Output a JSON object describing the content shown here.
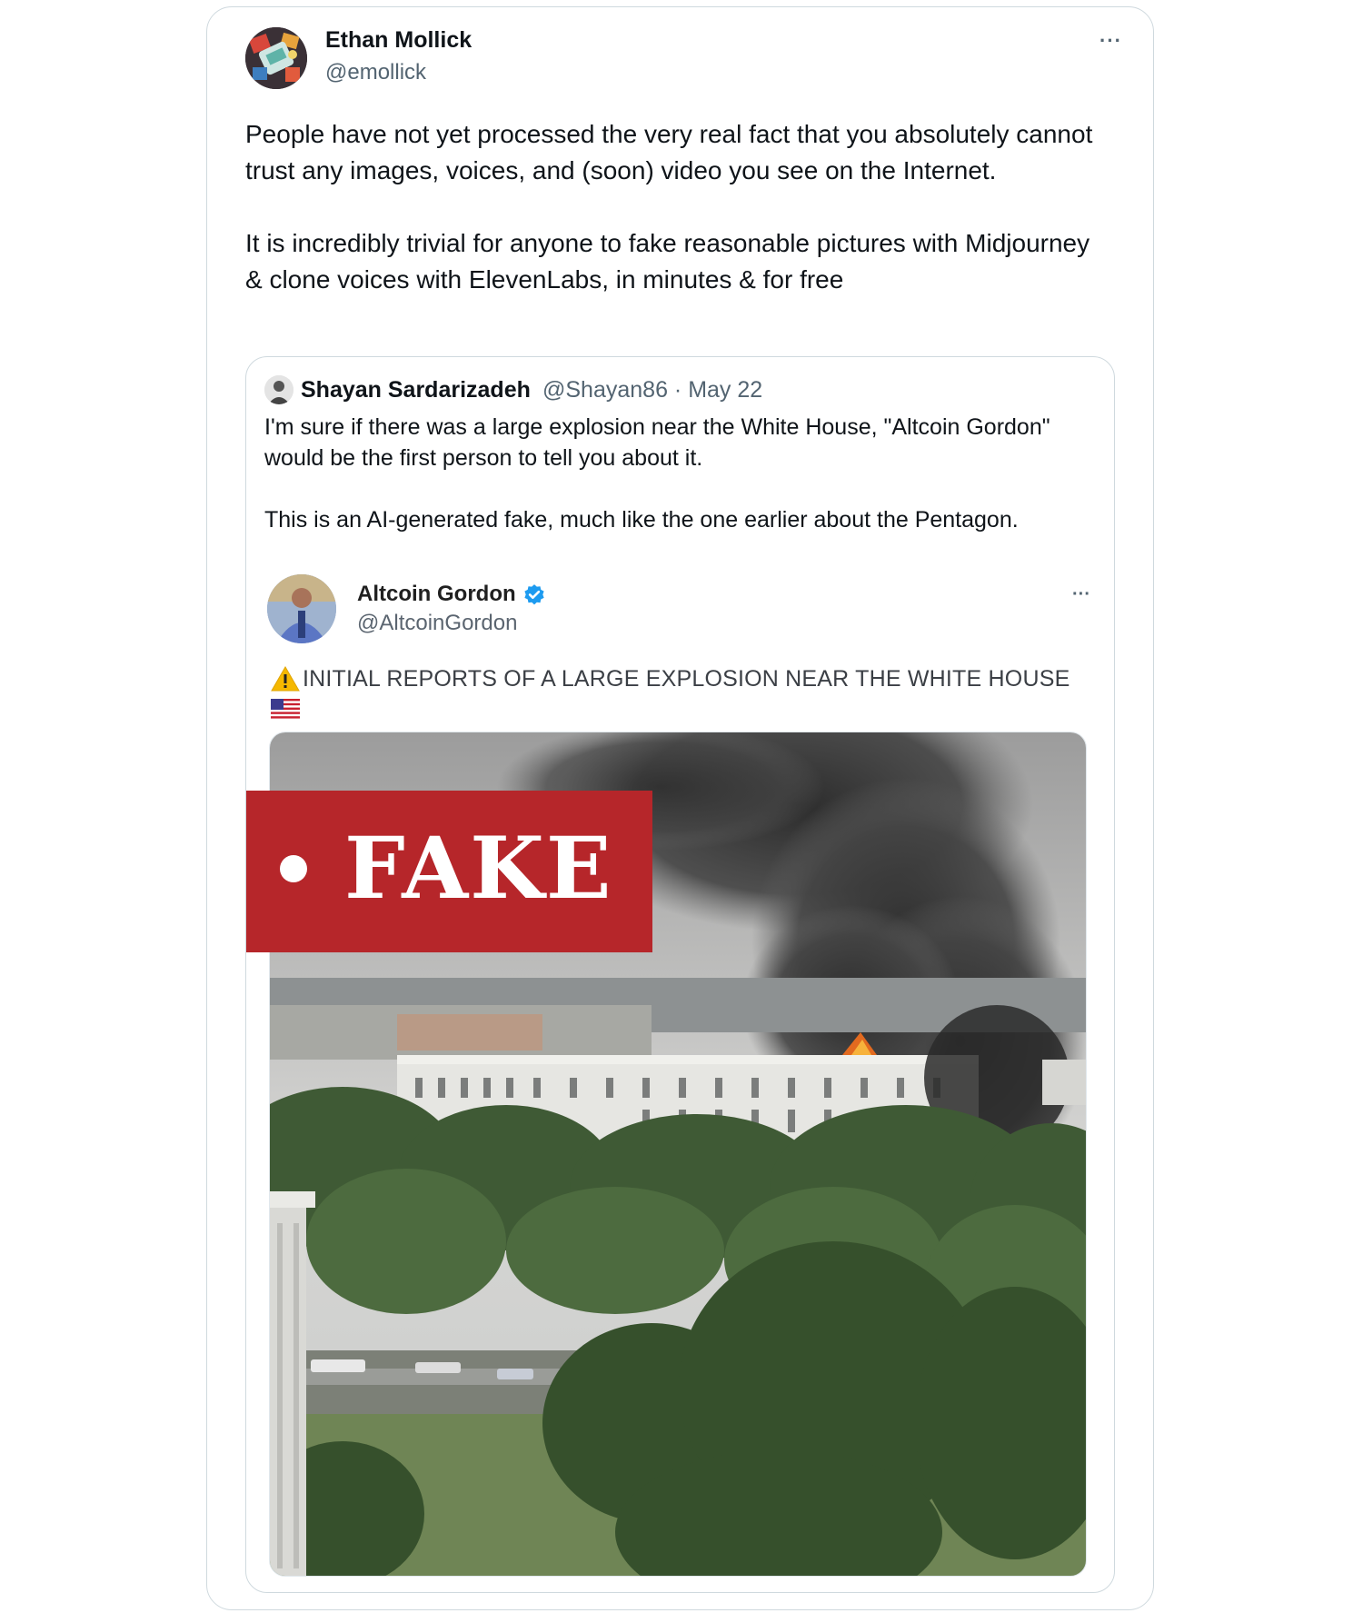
{
  "tweet": {
    "author_name": "Ethan Mollick",
    "author_handle": "@emollick",
    "more_icon": "···",
    "text_p1": "People have not yet processed the very real fact that you absolutely cannot trust any images, voices, and (soon) video you see on the Internet.",
    "text_p2": "It is incredibly trivial for anyone to fake reasonable pictures with Midjourney & clone voices with ElevenLabs, in minutes & for free"
  },
  "quote": {
    "author_name": "Shayan Sardarizadeh",
    "meta": "@Shayan86 · May 22",
    "text_p1": "I'm sure if there was a large explosion near the White House, \"Altcoin Gordon\" would be the first person to tell you about it.",
    "text_p2": "This is an AI-generated fake, much like the one earlier about the Pentagon."
  },
  "embedded": {
    "author_name": "Altcoin Gordon",
    "author_handle": "@AltcoinGordon",
    "more_icon": "···",
    "text": "INITIAL REPORTS OF A LARGE EXPLOSION NEAR THE WHITE HOUSE",
    "verified_color": "#1d9bf0"
  },
  "image": {
    "label": "FAKE",
    "banner_color": "#b6262a"
  }
}
